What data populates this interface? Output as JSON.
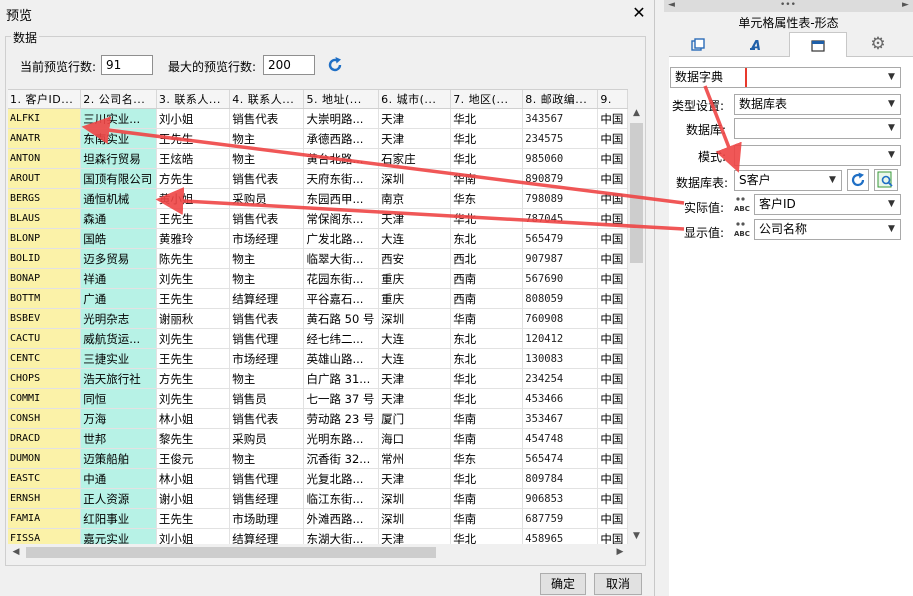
{
  "dialog": {
    "title": "预览",
    "close_glyph": "✕",
    "group_label": "数据",
    "current_rows_label": "当前预览行数:",
    "current_rows_value": "91",
    "max_rows_label": "最大的预览行数:",
    "max_rows_value": "200",
    "ok_label": "确定",
    "cancel_label": "取消"
  },
  "grid": {
    "columns": [
      "1. 客户ID...",
      "2. 公司名...",
      "3. 联系人...",
      "4. 联系人...",
      "5. 地址(...",
      "6. 城市(...",
      "7. 地区(...",
      "8. 邮政编...",
      "9."
    ],
    "rows": [
      [
        "ALFKI",
        "三川实业...",
        "刘小姐",
        "销售代表",
        "大崇明路...",
        "天津",
        "华北",
        "343567",
        "中国"
      ],
      [
        "ANATR",
        "东南实业",
        "王先生",
        "物主",
        "承德西路...",
        "天津",
        "华北",
        "234575",
        "中国"
      ],
      [
        "ANTON",
        "坦森行贸易",
        "王炫皓",
        "物主",
        "黄台北路...",
        "石家庄",
        "华北",
        "985060",
        "中国"
      ],
      [
        "AROUT",
        "国顶有限公司",
        "方先生",
        "销售代表",
        "天府东街...",
        "深圳",
        "华南",
        "890879",
        "中国"
      ],
      [
        "BERGS",
        "通恒机械",
        "黄小姐",
        "采购员",
        "东园西甲...",
        "南京",
        "华东",
        "798089",
        "中国"
      ],
      [
        "BLAUS",
        "森通",
        "王先生",
        "销售代表",
        "常保阁东...",
        "天津",
        "华北",
        "787045",
        "中国"
      ],
      [
        "BLONP",
        "国皓",
        "黄雅玲",
        "市场经理",
        "广发北路...",
        "大连",
        "东北",
        "565479",
        "中国"
      ],
      [
        "BOLID",
        "迈多贸易",
        "陈先生",
        "物主",
        "临翠大街...",
        "西安",
        "西北",
        "907987",
        "中国"
      ],
      [
        "BONAP",
        "祥通",
        "刘先生",
        "物主",
        "花园东街...",
        "重庆",
        "西南",
        "567690",
        "中国"
      ],
      [
        "BOTTM",
        "广通",
        "王先生",
        "结算经理",
        "平谷嘉石...",
        "重庆",
        "西南",
        "808059",
        "中国"
      ],
      [
        "BSBEV",
        "光明杂志",
        "谢丽秋",
        "销售代表",
        "黄石路 50 号",
        "深圳",
        "华南",
        "760908",
        "中国"
      ],
      [
        "CACTU",
        "威航货运...",
        "刘先生",
        "销售代理",
        "经七纬二...",
        "大连",
        "东北",
        "120412",
        "中国"
      ],
      [
        "CENTC",
        "三捷实业",
        "王先生",
        "市场经理",
        "英雄山路...",
        "大连",
        "东北",
        "130083",
        "中国"
      ],
      [
        "CHOPS",
        "浩天旅行社",
        "方先生",
        "物主",
        "白广路 31...",
        "天津",
        "华北",
        "234254",
        "中国"
      ],
      [
        "COMMI",
        "同恒",
        "刘先生",
        "销售员",
        "七一路 37 号",
        "天津",
        "华北",
        "453466",
        "中国"
      ],
      [
        "CONSH",
        "万海",
        "林小姐",
        "销售代表",
        "劳动路 23 号",
        "厦门",
        "华南",
        "353467",
        "中国"
      ],
      [
        "DRACD",
        "世邦",
        "黎先生",
        "采购员",
        "光明东路...",
        "海口",
        "华南",
        "454748",
        "中国"
      ],
      [
        "DUMON",
        "迈策船舶",
        "王俊元",
        "物主",
        "沉香街 32...",
        "常州",
        "华东",
        "565474",
        "中国"
      ],
      [
        "EASTC",
        "中通",
        "林小姐",
        "销售代理",
        "光复北路...",
        "天津",
        "华北",
        "809784",
        "中国"
      ],
      [
        "ERNSH",
        "正人资源",
        "谢小姐",
        "销售经理",
        "临江东街...",
        "深圳",
        "华南",
        "906853",
        "中国"
      ],
      [
        "FAMIA",
        "红阳事业",
        "王先生",
        "市场助理",
        "外滩西路...",
        "深圳",
        "华南",
        "687759",
        "中国"
      ],
      [
        "FISSA",
        "嘉元实业",
        "刘小姐",
        "结算经理",
        "东湖大街...",
        "天津",
        "华北",
        "458965",
        "中国"
      ]
    ]
  },
  "panel": {
    "title": "单元格属性表-形态",
    "tab_icons": [
      "cell-icon",
      "font-a-icon",
      "form-icon",
      "gear-icon"
    ],
    "dict_type_value": "数据字典",
    "type_label": "类型设置:",
    "type_value": "数据库表",
    "datasource_label": "数据库:",
    "datasource_value": "",
    "mode_label": "模式:",
    "mode_value": "",
    "table_label": "数据库表:",
    "table_value": "S客户",
    "actual_label": "实际值:",
    "actual_value": "客户ID",
    "display_label": "显示值:",
    "display_value": "公司名称"
  },
  "colors": {
    "id_column_bg": "#fbf2a8",
    "name_column_bg": "#b7f2e6",
    "highlight_red": "#e8392c",
    "refresh_blue": "#1f6fc5"
  }
}
